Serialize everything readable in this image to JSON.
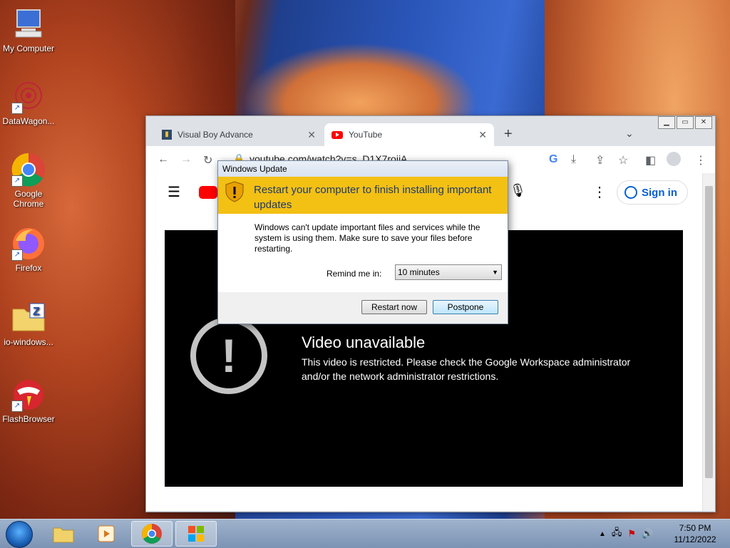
{
  "desktop": {
    "icons": [
      {
        "label": "My Computer"
      },
      {
        "label": "DataWagon..."
      },
      {
        "label": "Google Chrome"
      },
      {
        "label": "Firefox"
      },
      {
        "label": "io-windows..."
      },
      {
        "label": "FlashBrowser"
      }
    ]
  },
  "browser": {
    "tabs": [
      {
        "label": "Visual Boy Advance"
      },
      {
        "label": "YouTube"
      }
    ],
    "url": "youtube.com/watch?v=s_D1X7rojjA",
    "youtube": {
      "sign_in_label": "Sign in",
      "error_title": "Video unavailable",
      "error_message": "This video is restricted. Please check the Google Workspace administrator and/or the network administrator restrictions."
    }
  },
  "dialog": {
    "title": "Windows Update",
    "heading": "Restart your computer to finish installing important updates",
    "body": "Windows can't update important files and services while the system is using them. Make sure to save your files before restarting.",
    "remind_label": "Remind me in:",
    "remind_value": "10 minutes",
    "restart_label": "Restart now",
    "postpone_label": "Postpone"
  },
  "taskbar": {
    "time": "7:50 PM",
    "date": "11/12/2022"
  }
}
